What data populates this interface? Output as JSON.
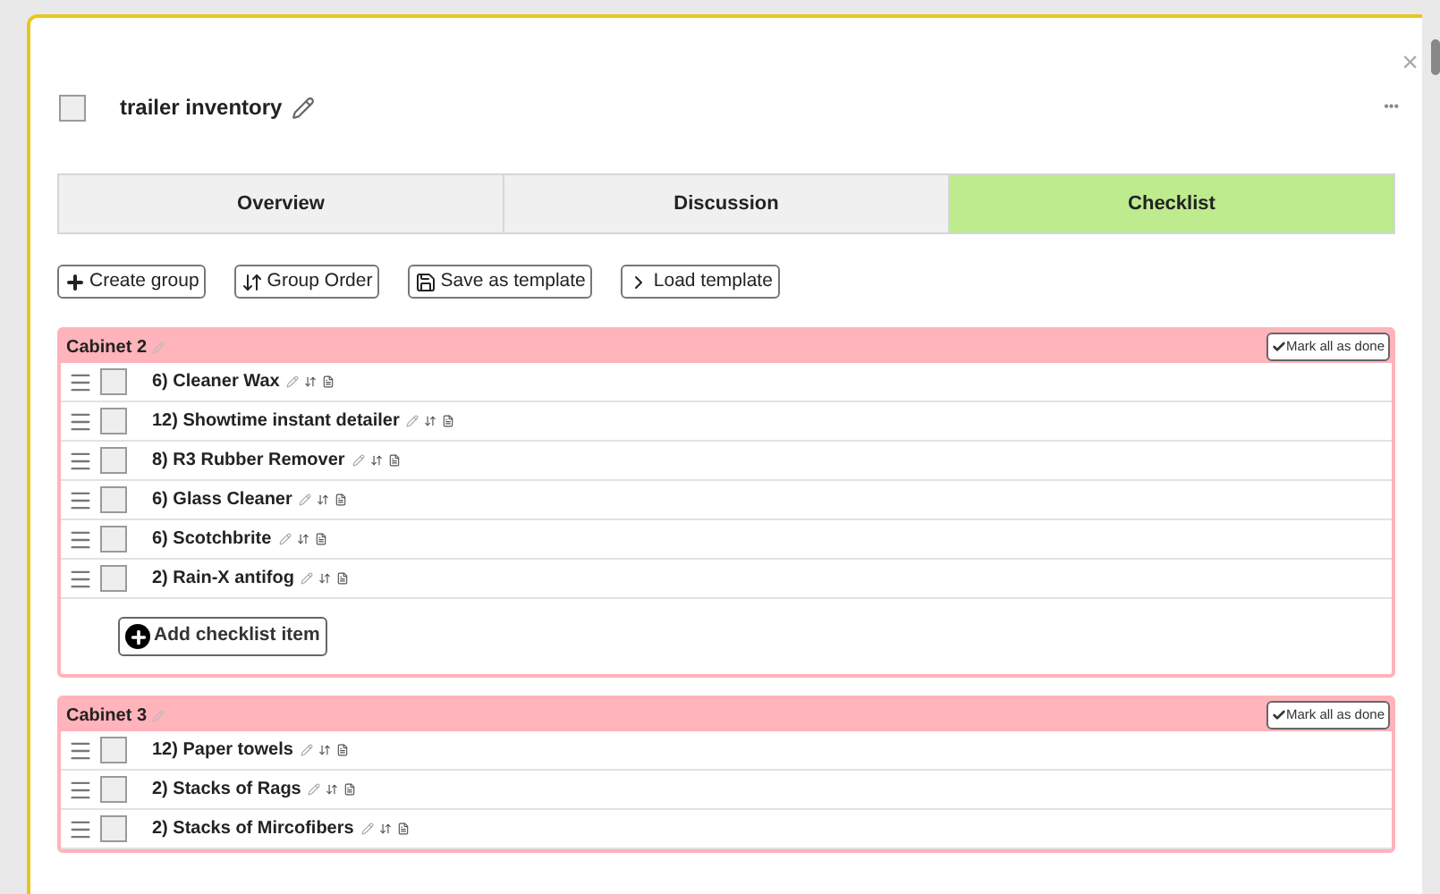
{
  "card": {
    "title": "trailer inventory",
    "checked": false,
    "close": "×",
    "more": "•••"
  },
  "tabs": [
    {
      "label": "Overview",
      "selected": false
    },
    {
      "label": "Discussion",
      "selected": false
    },
    {
      "label": "Checklist",
      "selected": true
    }
  ],
  "toolbar": [
    {
      "label": "Create group",
      "kind": "create"
    },
    {
      "label": "Group Order",
      "kind": "order"
    },
    {
      "label": "Save as template",
      "kind": "save"
    },
    {
      "label": "Load template",
      "kind": "load"
    }
  ],
  "groups": [
    {
      "name": "Cabinet 2",
      "mark_all": "Mark all as done",
      "add_item": "Add checklist item",
      "items": [
        {
          "label": "6) Cleaner Wax",
          "checked": false
        },
        {
          "label": "12) Showtime instant detailer",
          "checked": false
        },
        {
          "label": "8) R3 Rubber Remover",
          "checked": false
        },
        {
          "label": "6) Glass Cleaner",
          "checked": false
        },
        {
          "label": "6) Scotchbrite",
          "checked": false
        },
        {
          "label": "2) Rain-X antifog",
          "checked": false
        }
      ]
    },
    {
      "name": "Cabinet 3",
      "mark_all": "Mark all as done",
      "items": [
        {
          "label": "12) Paper towels",
          "checked": false
        },
        {
          "label": "2) Stacks of Rags",
          "checked": false
        },
        {
          "label": "2) Stacks of Mircofibers",
          "checked": false
        }
      ]
    }
  ]
}
